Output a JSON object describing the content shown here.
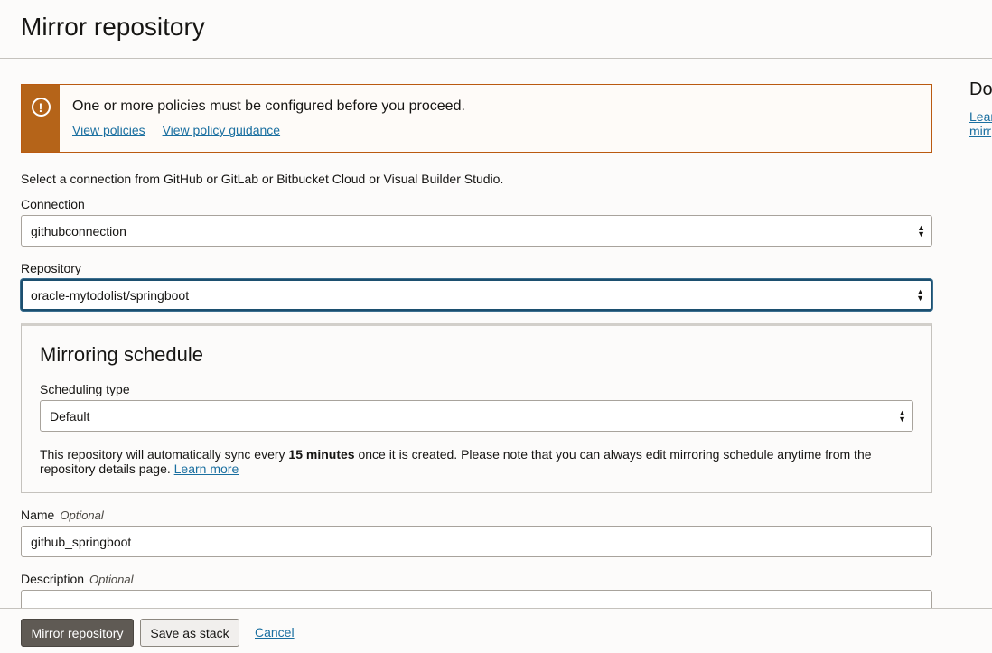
{
  "header": {
    "title": "Mirror repository"
  },
  "right_panel": {
    "title": "Do",
    "link_line1": "Lear",
    "link_line2": "mirr"
  },
  "alert": {
    "message": "One or more policies must be configured before you proceed.",
    "links": [
      "View policies",
      "View policy guidance"
    ],
    "icon": "!"
  },
  "form": {
    "intro": "Select a connection from GitHub or GitLab or Bitbucket Cloud or Visual Builder Studio.",
    "connection": {
      "label": "Connection",
      "value": "githubconnection"
    },
    "repository": {
      "label": "Repository",
      "value": "oracle-mytodolist/springboot"
    },
    "schedule": {
      "title": "Mirroring schedule",
      "type_label": "Scheduling type",
      "type_value": "Default",
      "note_before": "This repository will automatically sync every ",
      "note_bold": "15 minutes",
      "note_after": " once it is created. Please note that you can always edit mirroring schedule anytime from the repository details page. ",
      "note_link": "Learn more"
    },
    "name": {
      "label": "Name",
      "optional": "Optional",
      "value": "github_springboot"
    },
    "description": {
      "label": "Description",
      "optional": "Optional",
      "value": ""
    }
  },
  "footer": {
    "primary": "Mirror repository",
    "secondary": "Save as stack",
    "cancel": "Cancel"
  },
  "colors": {
    "accent_warning": "#b56419",
    "link": "#1a6fa0",
    "primary_button": "#5f5a54"
  }
}
